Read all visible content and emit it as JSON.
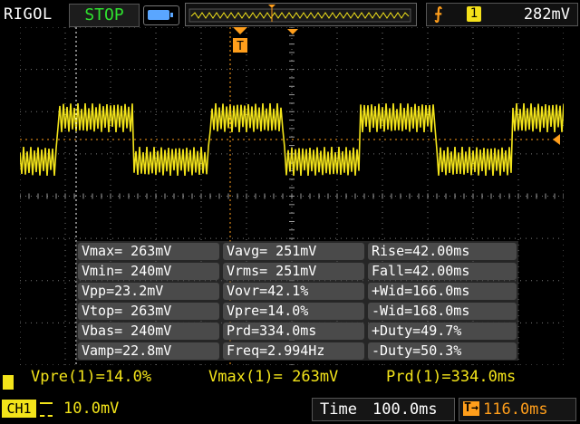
{
  "header": {
    "brand": "RIGOL",
    "run_state": "STOP",
    "trigger_channel": "1",
    "trigger_level": "282mV"
  },
  "measurements": [
    [
      "Vmax= 263mV",
      "Vavg= 251mV",
      "Rise=42.00ms"
    ],
    [
      "Vmin= 240mV",
      "Vrms= 251mV",
      "Fall=42.00ms"
    ],
    [
      "Vpp=23.2mV",
      "Vovr=42.1%",
      "+Wid=166.0ms"
    ],
    [
      "Vtop= 263mV",
      "Vpre=14.0%",
      "-Wid=168.0ms"
    ],
    [
      "Vbas= 240mV",
      "Prd=334.0ms",
      "+Duty=49.7%"
    ],
    [
      "Vamp=22.8mV",
      "Freq=2.994Hz",
      "-Duty=50.3%"
    ]
  ],
  "quick_measure": {
    "m1": "Vpre(1)=14.0%",
    "m2": "Vmax(1)= 263mV",
    "m3": "Prd(1)=334.0ms"
  },
  "footer": {
    "channel": "CH1",
    "channel_scale": "10.0mV",
    "time_label": "Time",
    "timebase": "100.0ms",
    "trigger_delay": "116.0ms"
  },
  "signal": {
    "period_ms": 334.0,
    "duty_percent": 49.7,
    "vmax_mv": 263,
    "vmin_mv": 240,
    "color": "#f3e41a"
  },
  "colors": {
    "trace": "#f3e41a",
    "trigger": "#ff9e1b",
    "run_state": "#2fe02f",
    "grid": "#7a7a7a"
  },
  "icons": [
    "battery-icon",
    "trigger-edge-icon",
    "trigger-marker-icon",
    "coupling-icon"
  ]
}
